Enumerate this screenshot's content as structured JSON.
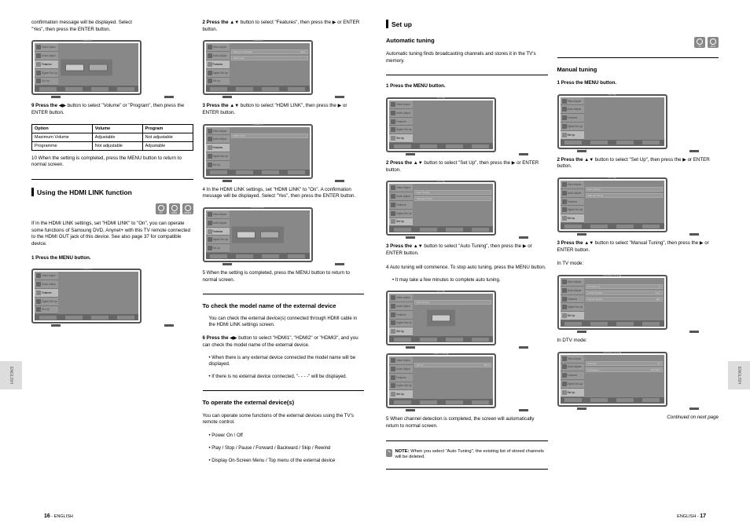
{
  "edgeLabel": "ENGLISH",
  "pageLeft": {
    "num": "16",
    "label": " - ENGLISH"
  },
  "pageRight": {
    "label": "ENGLISH - ",
    "num": "17"
  },
  "left": {
    "col1": {
      "line1": "confirmation message will be displayed. Select",
      "line2": "\"Yes\", then press the ENTER button.",
      "tv1": {
        "menu": [
          "Video Adjust",
          "Audio Adjust",
          "Features",
          "Digital Set-Up",
          "Set Up"
        ],
        "activeIndex": 2,
        "title": "Features",
        "confirm": {
          "yes": "Yes",
          "no": "No"
        }
      },
      "step9a": "9  Press the ",
      "step9b": " button to select \"Volume\" or \"Program\", then press the ENTER button.",
      "tableTitle": "Option",
      "table": {
        "headers": [
          "Option",
          "Volume",
          "Program"
        ],
        "rows": [
          [
            "Maximum Volume",
            "Adjustable",
            "Not adjustable"
          ],
          [
            "Programme",
            "Not adjustable",
            "Adjustable"
          ]
        ]
      },
      "step10": "10 When the setting is completed, press the MENU button to return to normal screen.",
      "heading": "Using the HDMI LINK function",
      "iconRow": [
        "TV",
        "HDMI",
        "VIDEO"
      ],
      "intro": "If in the HDMI LINK settings, set \"HDMI LINK\" to \"On\", you can operate some functions of Samsung DVD, Anynet+ with this TV remote connected to the HDMI OUT jack of this device. See also page 37 for compatible device.",
      "step1": "1  Press the MENU button.",
      "tv2": {
        "menu": [
          "Video Adjust",
          "Audio Adjust",
          "Features",
          "Digital Set-Up",
          "Set Up"
        ],
        "activeIndex": 2,
        "title": "Features"
      }
    },
    "col2": {
      "step2a": "2  Press the ",
      "step2b": " button to select \"Features\", then press the ",
      "step2c": " or ENTER button.",
      "tv3": {
        "menu": [
          "Video Adjust",
          "Audio Adjust",
          "Features",
          "Digital Set-Up",
          "Set Up"
        ],
        "activeIndex": 2,
        "title": "Features",
        "bars": [
          {
            "l": "Teletext Language",
            "r": "East"
          },
          {
            "l": "Child Lock",
            "r": ""
          }
        ]
      },
      "step3a": "3  Press the ",
      "step3b": " button to select \"HDMI LINK\", then press the ",
      "step3c": " or ENTER button.",
      "tv4": {
        "menu": [
          "Video Adjust",
          "Audio Adjust",
          "Features",
          "Digital Set-Up",
          "Set Up"
        ],
        "activeIndex": 2,
        "title": "Features",
        "bars": [
          {
            "l": "HDMI LINK",
            "r": ""
          }
        ]
      },
      "step4": "4  In the HDMI LINK settings, set \"HDMI LINK\" to \"On\". A confirmation message will be displayed. Select \"Yes\", then press the ENTER button.",
      "tv5": {
        "menu": [
          "Video Adjust",
          "Audio Adjust",
          "Features",
          "Digital Set-Up",
          "Set Up"
        ],
        "activeIndex": 2,
        "title": "HDMI LINK",
        "confirm": {
          "yes": "Yes",
          "no": "No"
        }
      },
      "step5": "5  When the setting is completed, press the MENU button to return to normal screen.",
      "sectionA": "To check the model name of the external device",
      "bulletA1": "You can check the external device(s) connected through HDMI cable in the HDMI LINK settings screen.",
      "step6a": "6  Press the ",
      "step6b": " button to select \"HDMI1\", \"HDMI2\" or \"HDMI3\", and you can check the model name of the external device.",
      "bullet6a": "When there is any external device connected the model name will be displayed.",
      "bullet6b": "If there is no external device connected, \"- - - -\" will be displayed.",
      "sectionB": "To operate the external device(s)",
      "paraB": "You can operate some functions of the external devices using the TV's remote control.",
      "bulletB1": "Power On / Off",
      "bulletB2": "Play / Stop / Pause / Forward / Backward / Skip / Rewind",
      "bulletB3": "Display On-Screen Menu / Top menu of the external device"
    }
  },
  "right": {
    "col1": {
      "heading": "Set up",
      "sectionAuto": "Automatic tuning",
      "intro": "Automatic tuning finds broadcasting channels and stores it in the TV's memory.",
      "step1": "1  Press the MENU button.",
      "tv1": {
        "menu": [
          "Video Adjust",
          "Audio Adjust",
          "Features",
          "Digital Set-Up",
          "Set Up"
        ],
        "activeIndex": 4,
        "title": "Set Up"
      },
      "step2a": "2  Press the ",
      "step2b": " button to select \"Set Up\", then press the ",
      "step2c": " or ENTER button.",
      "tv2": {
        "menu": [
          "Video Adjust",
          "Audio Adjust",
          "Features",
          "Digital Set-Up",
          "Set Up"
        ],
        "activeIndex": 4,
        "title": "Set Up",
        "bars": [
          {
            "l": "Auto Tuning",
            "r": ""
          },
          {
            "l": "Manual Tuning",
            "r": ""
          }
        ]
      },
      "step3a": "3  Press the ",
      "step3b": " button to select \"Auto Tuning\", then press the ",
      "step3c": " or ENTER button.",
      "tv3": {
        "menu": [
          "Video Adjust",
          "Audio Adjust",
          "Features",
          "Digital Set-Up",
          "Set Up"
        ],
        "activeIndex": 4,
        "title": "Set Up",
        "bars": [
          {
            "l": "Auto Tuning",
            "r": ""
          }
        ],
        "confirm": {
          "yes": "Start",
          "no": ""
        }
      },
      "step4": "4  Auto tuning will commence. To stop auto tuning, press the MENU button.",
      "bullet4": "It may take a few minutes to complete auto tuning.",
      "tv4": {
        "menu": [
          "Video Adjust",
          "Audio Adjust",
          "Features",
          "Digital Set-Up",
          "Set Up"
        ],
        "activeIndex": 4,
        "title": "Auto Tuning",
        "bars": [
          {
            "l": "CH 21",
            "r": "68 %"
          }
        ]
      },
      "step5": "5  When channel detection is completed, the screen will automatically return to normal screen.",
      "noteIcon": "✎",
      "noteLabel": "NOTE:",
      "noteText": "When you select \"Auto Tuning\", the existing list of stored channels will be deleted."
    },
    "col2": {
      "iconRow": [
        "TV",
        "DTV"
      ],
      "sectionManual": "Manual tuning",
      "step1": "1  Press the MENU button.",
      "tv1": {
        "menu": [
          "Video Adjust",
          "Audio Adjust",
          "Features",
          "Digital Set-Up",
          "Set Up"
        ],
        "activeIndex": 4,
        "title": "Set Up"
      },
      "step2a": "2  Press the ",
      "step2b": " button to select \"Set Up\", then press the ",
      "step2c": " or ENTER button.",
      "tv2": {
        "menu": [
          "Video Adjust",
          "Audio Adjust",
          "Features",
          "Digital Set-Up",
          "Set Up"
        ],
        "activeIndex": 4,
        "title": "Set Up",
        "bars": [
          {
            "l": "Auto Tuning",
            "r": ""
          },
          {
            "l": "Manual Tuning",
            "r": ""
          }
        ]
      },
      "step3a": "3  Press the ",
      "step3b": " button to select \"Manual Tuning\", then press the ",
      "step3c": " or ENTER button.",
      "step4": "In TV mode:",
      "tv3": {
        "menu": [
          "Video Adjust",
          "Audio Adjust",
          "Features",
          "Digital Set-Up",
          "Set Up"
        ],
        "activeIndex": 4,
        "title": "Manual Tuning",
        "bars": [
          {
            "l": "Programme",
            "r": "1"
          },
          {
            "l": "Colour System",
            "r": "Auto"
          },
          {
            "l": "Sound System",
            "r": "BG"
          }
        ]
      },
      "step4b": "In DTV mode:",
      "tv4": {
        "menu": [
          "Video Adjust",
          "Audio Adjust",
          "Features",
          "Digital Set-Up",
          "Set Up"
        ],
        "activeIndex": 4,
        "title": "Manual Tuning",
        "bars": [
          {
            "l": "Channel",
            "r": "21"
          },
          {
            "l": "Frequency",
            "r": "474 MHz"
          }
        ]
      },
      "footer": "Continued on next page"
    }
  }
}
